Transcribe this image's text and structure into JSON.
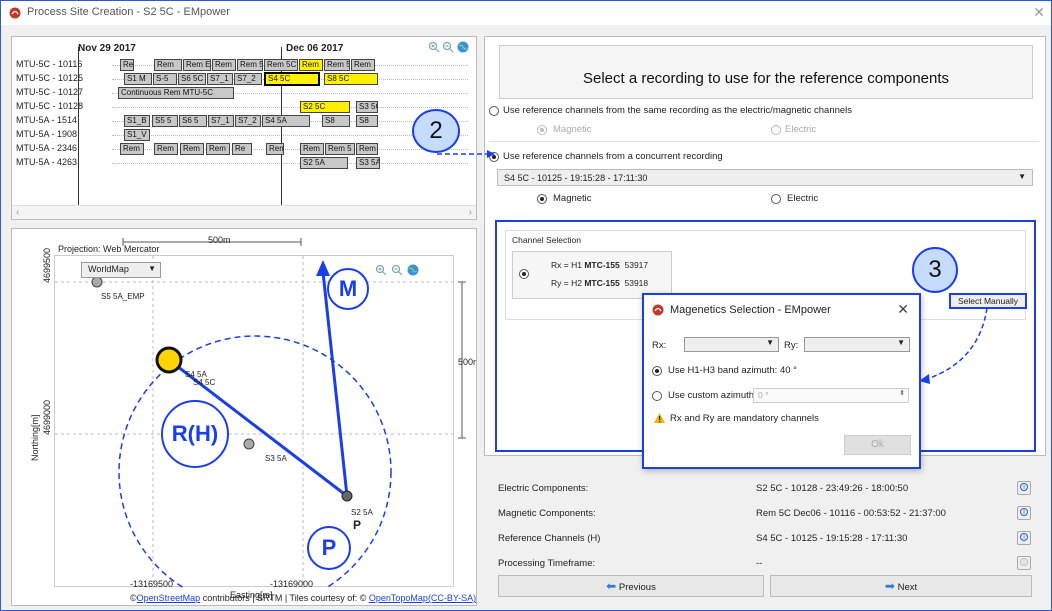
{
  "window": {
    "title": "Process Site Creation - S2 5C  - EMpower",
    "close": "✕"
  },
  "timeline": {
    "dates": [
      "Nov 29 2017",
      "Dec 06 2017"
    ],
    "rows": [
      {
        "label": "MTU-5C - 10116"
      },
      {
        "label": "MTU-5C - 10125"
      },
      {
        "label": "MTU-5C - 10127"
      },
      {
        "label": "MTU-5C - 10128"
      },
      {
        "label": "MTU-5A - 1514"
      },
      {
        "label": "MTU-5A - 1908"
      },
      {
        "label": "MTU-5A - 2346"
      },
      {
        "label": "MTU-5A - 4263"
      }
    ],
    "blocks": [
      {
        "text": "Rec"
      },
      {
        "text": "Rem"
      },
      {
        "text": "Rem E"
      },
      {
        "text": "Rem"
      },
      {
        "text": "Rem 5"
      },
      {
        "text": "Rem 5C"
      },
      {
        "text": "Rem"
      },
      {
        "text": "Rem 5"
      },
      {
        "text": "Rem"
      },
      {
        "text": "S1 M"
      },
      {
        "text": "S-5"
      },
      {
        "text": "S6 5C"
      },
      {
        "text": "S7_1"
      },
      {
        "text": "S7_2"
      },
      {
        "text": "S4 5C"
      },
      {
        "text": "S8 5C"
      },
      {
        "text": "Continuous Rem MTU-5C"
      },
      {
        "text": "S2 5C"
      },
      {
        "text": "S3 5C"
      },
      {
        "text": "S1_B"
      },
      {
        "text": "S5 5"
      },
      {
        "text": "S6 5"
      },
      {
        "text": "S7_1"
      },
      {
        "text": "S7_2"
      },
      {
        "text": "S4 5A"
      },
      {
        "text": "S8"
      },
      {
        "text": "S8"
      },
      {
        "text": "S1_V"
      },
      {
        "text": "Rem"
      },
      {
        "text": "Rem"
      },
      {
        "text": "Rem"
      },
      {
        "text": "Rem"
      },
      {
        "text": "Re"
      },
      {
        "text": "Rem"
      },
      {
        "text": "Rem"
      },
      {
        "text": "Rem 5"
      },
      {
        "text": "Rem"
      },
      {
        "text": "S2 5A"
      },
      {
        "text": "S3 5A"
      }
    ]
  },
  "map": {
    "projection": "Projection: Web Mercator",
    "scale_top": "500m",
    "scale_right": "500m",
    "basemap": "WorldMap",
    "y_ticks": [
      "4699500",
      "4699000"
    ],
    "x_ticks": [
      "-13169500",
      "-13169000"
    ],
    "ylabel": "Northing[m]",
    "xlabel": "Easting[m]",
    "sites": {
      "s5": "S5 5A_EMP",
      "s4a": "S4 5A",
      "s4c": "S4 5C",
      "s3": "S3 5A",
      "s2": "S2 5A",
      "p_label": "P"
    },
    "attribution": {
      "prefix": "©",
      "osm": "OpenStreetMap",
      "mid": " contributors | SRTM | Tiles courtesy of: © ",
      "otm": "OpenTopoMap",
      "cc": "(CC-BY-SA)"
    },
    "markers": {
      "m": "M",
      "rh": "R(H)",
      "p": "P"
    }
  },
  "right": {
    "header": "Select a recording to use for the reference components",
    "opt_same": "Use reference channels from the same recording as the electric/magnetic channels",
    "opt_same_mag": "Magnetic",
    "opt_same_elec": "Electric",
    "opt_concurrent": "Use reference channels from a concurrent recording",
    "recording": "S4 5C - 10125 - 19:15:28 - 17:11:30",
    "mag": "Magnetic",
    "elec": "Electric",
    "channel_selection": {
      "title": "Channel Selection",
      "rx_prefix": "Rx = H1 ",
      "rx_model": "MTC-155",
      "rx_serial": "53917",
      "ry_prefix": "Ry = H2 ",
      "ry_model": "MTC-155",
      "ry_serial": "53918"
    },
    "select_manually": "Select Manually"
  },
  "info": {
    "rows": [
      {
        "label": "Electric Components:",
        "value": "S2 5C  - 10128 - 23:49:26 - 18:00:50"
      },
      {
        "label": "Magnetic Components:",
        "value": "Rem 5C Dec06 - 10116 - 00:53:52 - 21:37:00"
      },
      {
        "label": "Reference Channels (H)",
        "value": "S4 5C - 10125 - 19:15:28 - 17:11:30"
      },
      {
        "label": "Processing Timeframe:",
        "value": "--"
      }
    ],
    "info_glyph": "i",
    "previous": "Previous",
    "next": "Next"
  },
  "dialog": {
    "title": "Magenetics Selection - EMpower",
    "close": "✕",
    "rx": "Rx:",
    "ry": "Ry:",
    "opt_band": "Use H1-H3 band azimuth: 40 °",
    "opt_custom": "Use custom azimuth",
    "custom_value": "0 °",
    "warning": "Rx and Ry are mandatory channels",
    "ok": "Ok"
  },
  "callouts": {
    "two": "2",
    "three": "3"
  },
  "colors": {
    "accent": "#1a3ee8",
    "highlight": "#fff000",
    "callout_fill": "#c5dcff"
  }
}
